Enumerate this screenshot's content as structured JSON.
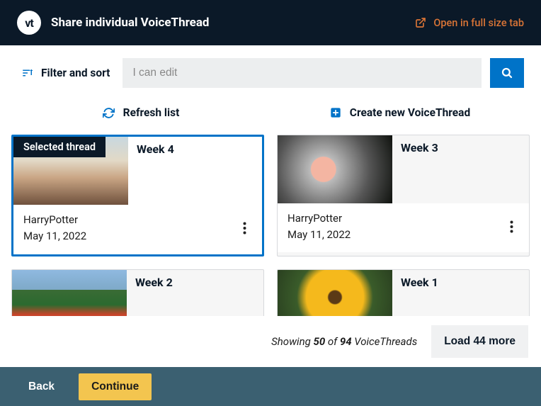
{
  "header": {
    "logo_text": "vt",
    "title": "Share individual VoiceThread",
    "open_tab_label": "Open in full size tab"
  },
  "toolbar": {
    "filter_sort_label": "Filter and sort",
    "search_placeholder": "I can edit",
    "refresh_label": "Refresh list",
    "create_new_label": "Create new VoiceThread"
  },
  "selected_badge": "Selected thread",
  "threads": [
    {
      "title": "Week 4",
      "author": "HarryPotter",
      "date": "May 11, 2022",
      "thumb_class": "week4",
      "selected": true
    },
    {
      "title": "Week 3",
      "author": "HarryPotter",
      "date": "May 11, 2022",
      "thumb_class": "week3",
      "selected": false
    },
    {
      "title": "Week 2",
      "thumb_class": "week2",
      "selected": false
    },
    {
      "title": "Week 1",
      "thumb_class": "week1",
      "selected": false
    }
  ],
  "status": {
    "showing_prefix": "Showing ",
    "count": "50",
    "of_text": " of ",
    "total": "94",
    "suffix": " VoiceThreads",
    "load_more_label": "Load 44 more"
  },
  "footer": {
    "back_label": "Back",
    "continue_label": "Continue"
  },
  "colors": {
    "accent": "#0073c8",
    "header_bg": "#0b1928",
    "open_link": "#d97436",
    "continue_bg": "#f3c54f",
    "footer_bg": "#3b6071"
  }
}
